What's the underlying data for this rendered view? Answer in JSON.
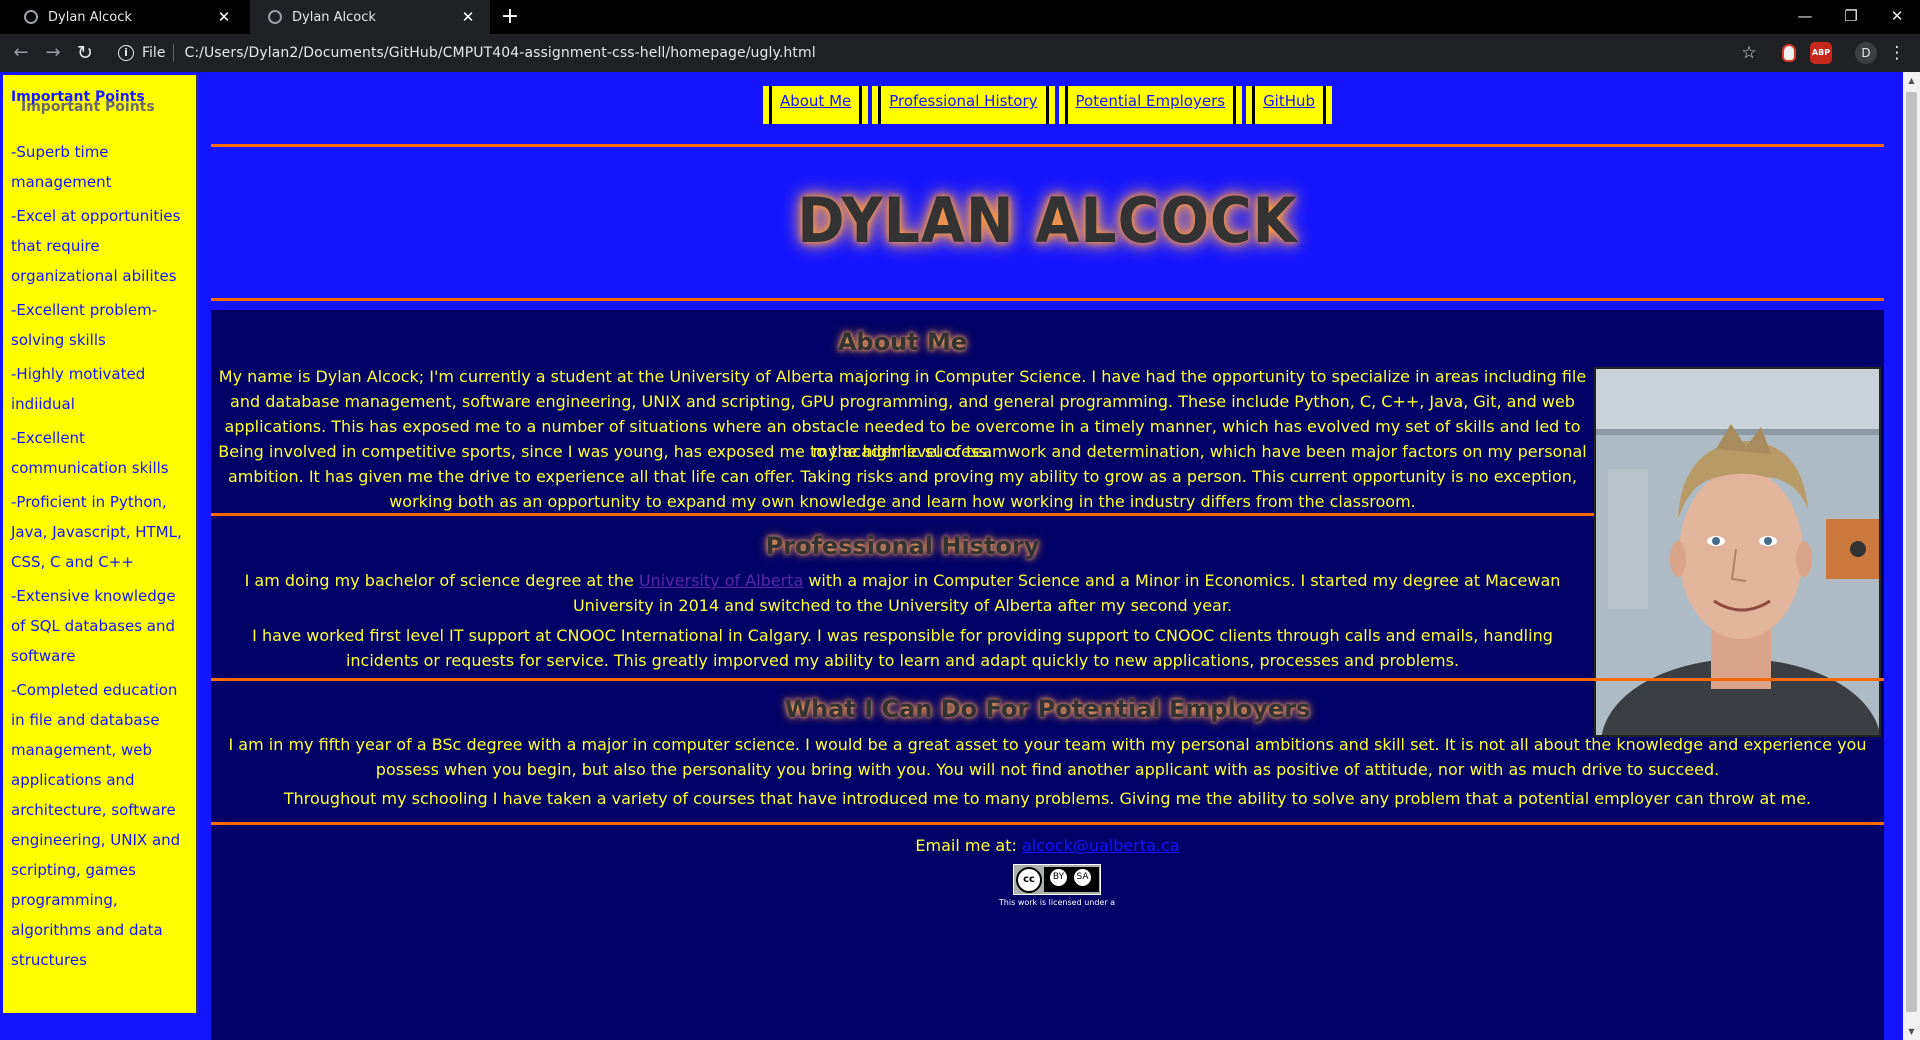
{
  "browser": {
    "tabs": [
      {
        "title": "Dylan Alcock",
        "active": false
      },
      {
        "title": "Dylan Alcock",
        "active": true
      }
    ],
    "new_tab_label": "+",
    "scheme_label": "File",
    "url": "C:/Users/Dylan2/Documents/GitHub/CMPUT404-assignment-css-hell/homepage/ugly.html",
    "extension_abp_label": "ABP",
    "profile_initial": "D"
  },
  "sidebar": {
    "title": "Important Points",
    "title_shadow": "Important Points",
    "items": [
      "-Superb time management",
      "-Excel at opportunities that require organizational abilites",
      "-Excellent problem-solving skills",
      "-Highly motivated indiidual",
      "-Excellent communication skills",
      "-Proficient in Python, Java, Javascript, HTML, CSS, C and C++",
      "-Extensive knowledge of SQL databases and software",
      "-Completed education in file and database management, web applications and architecture, software engineering, UNIX and scripting, games programming, algorithms and data structures"
    ]
  },
  "nav": {
    "about": "About Me",
    "history": "Professional History",
    "employers": "Potential Employers",
    "github": "GitHub"
  },
  "hero": {
    "title": "DYLAN ALCOCK"
  },
  "about": {
    "heading": "About Me",
    "p1": "My name is Dylan Alcock; I'm currently a student at the University of Alberta majoring in Computer Science. I have had the opportunity to specialize in areas including file and database management, software engineering, UNIX and scripting, GPU programming, and general programming. These include Python, C, C++, Java, Git, and web applications. This has exposed me to a number of situations where an obstacle needed to be overcome in a timely manner, which has evolved my set of skills and led to my academic success.",
    "p2": "Being involved in competitive sports, since I was young, has exposed me to the high level of teamwork and determination, which have been major factors on my personal ambition. It has given me the drive to experience all that life can offer. Taking risks and proving my ability to grow as a person. This current opportunity is no exception, working both as an opportunity to expand my own knowledge and learn how working in the industry differs from the classroom."
  },
  "history": {
    "heading": "Professional History",
    "p1_before": "I am doing my bachelor of science degree at the ",
    "p1_link": "University of Alberta",
    "p1_after": " with a major in Computer Science and a Minor in Economics. I started my degree at Macewan University in 2014 and switched to the University of Alberta after my second year.",
    "p2": "I have worked first level IT support at CNOOC International in Calgary. I was responsible for providing support to CNOOC clients through calls and emails, handling incidents or requests for service. This greatly imporved my ability to learn and adapt quickly to new applications, processes and problems."
  },
  "employers": {
    "heading": "What I Can Do For Potential Employers",
    "p1": "I am in my fifth year of a BSc degree with a major in computer science. I would be a great asset to your team with my personal ambitions and skill set. It is not all about the knowledge and experience you possess when you begin, but also the personality you bring with you. You will not find another applicant with as positive of attitude, nor with as much drive to succeed.",
    "p2": "Throughout my schooling I have taken a variety of courses that have introduced me to many problems. Giving me the ability to solve any problem that a potential employer can throw at me."
  },
  "footer": {
    "email_label": "Email me at: ",
    "email": "alcock@ualberta.ca",
    "cc_label": "cc",
    "cc_by": "BY",
    "cc_sa": "SA",
    "license_caption": "This work is licensed under a"
  },
  "colors": {
    "page_bg": "#1414ff",
    "sidebar_bg": "#ffff00",
    "content_bg": "#000066",
    "text_yellow": "#ffff33",
    "divider_orange": "#ff6a00"
  }
}
